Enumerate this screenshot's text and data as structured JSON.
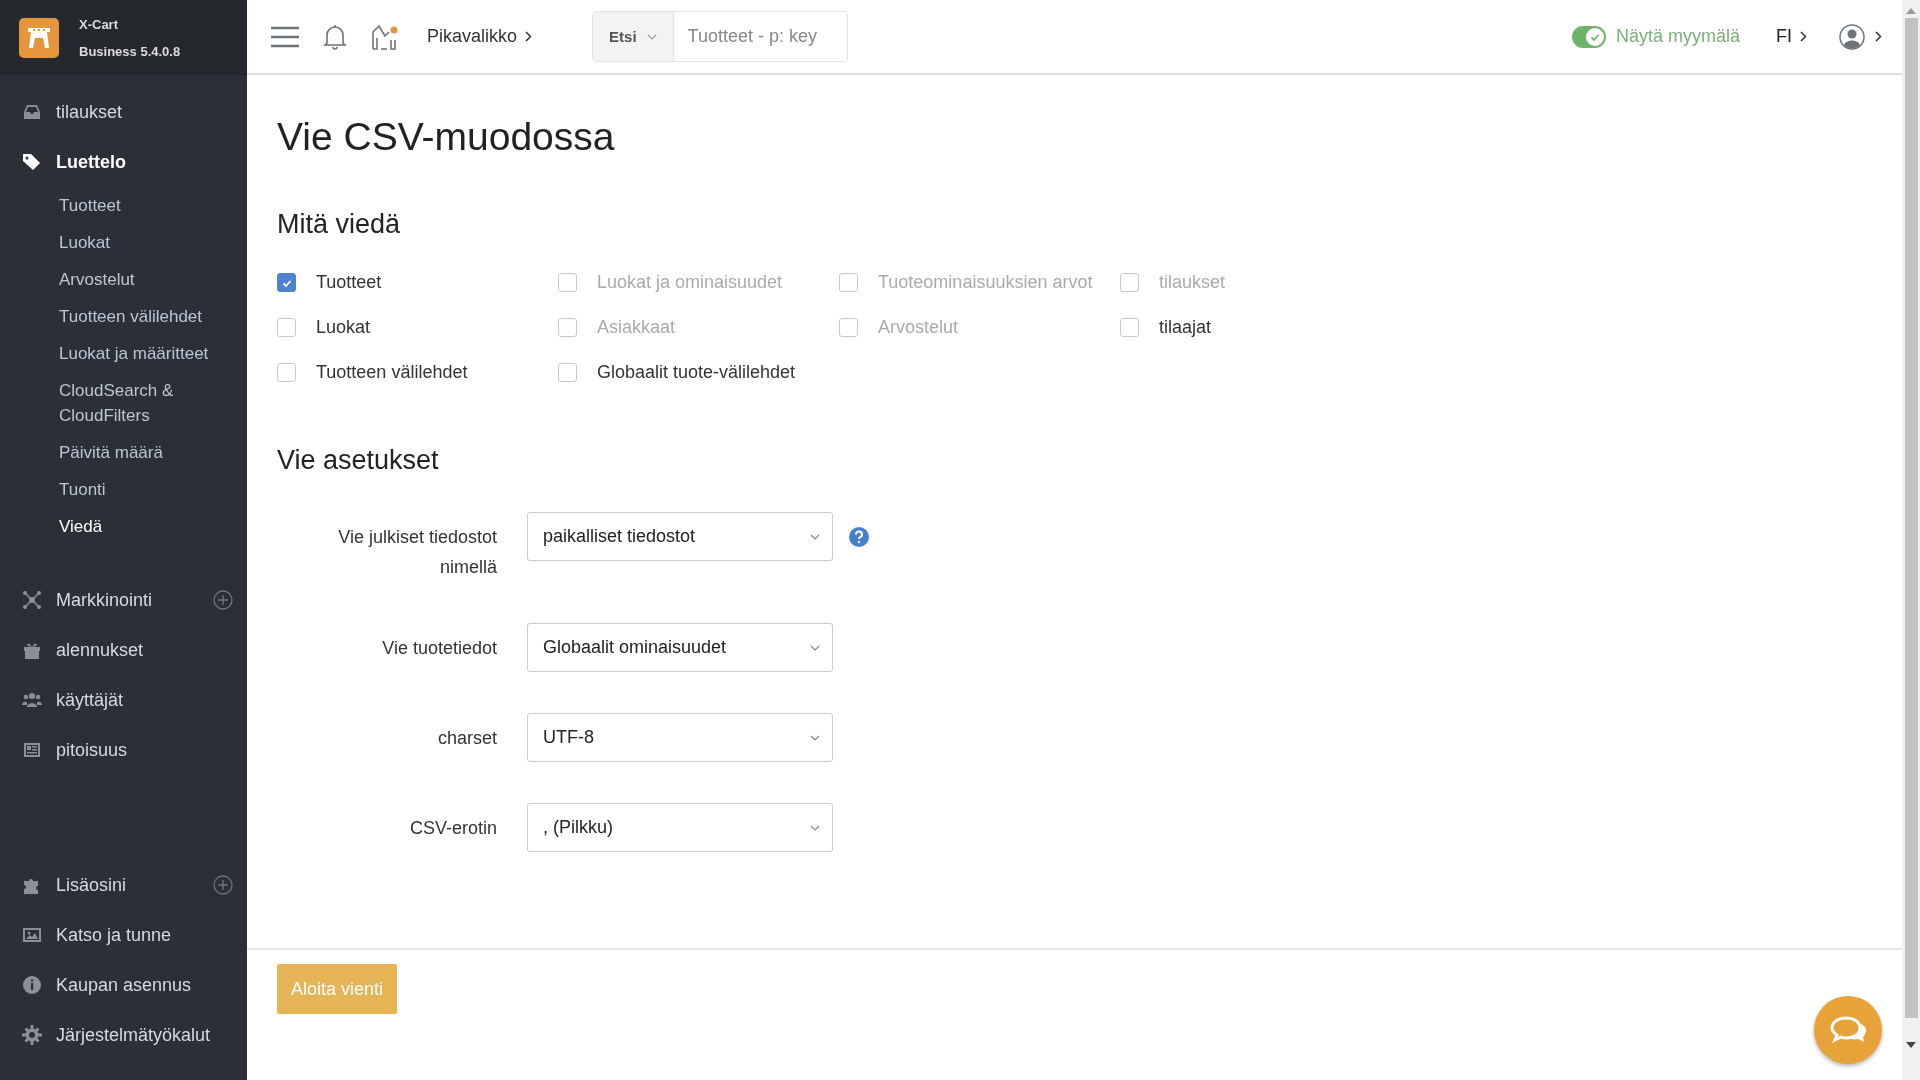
{
  "brand": {
    "name": "X-Cart",
    "version": "Business 5.4.0.8"
  },
  "sidebar": {
    "groups": [
      [
        {
          "label": "tilaukset",
          "expanded": false,
          "add": false
        },
        {
          "label": "Luettelo",
          "expanded": true,
          "add": false,
          "children": [
            {
              "label": "Tuotteet",
              "selected": false
            },
            {
              "label": "Luokat",
              "selected": false
            },
            {
              "label": "Arvostelut",
              "selected": false
            },
            {
              "label": "Tuotteen välilehdet",
              "selected": false
            },
            {
              "label": "Luokat ja määritteet",
              "selected": false
            },
            {
              "label": "CloudSearch & CloudFilters",
              "selected": false
            },
            {
              "label": "Päivitä määrä",
              "selected": false
            },
            {
              "label": "Tuonti",
              "selected": false
            },
            {
              "label": "Viedä",
              "selected": true
            }
          ]
        },
        {
          "label": "Markkinointi",
          "expanded": false,
          "add": true
        },
        {
          "label": "alennukset",
          "expanded": false,
          "add": false
        },
        {
          "label": "käyttäjät",
          "expanded": false,
          "add": false
        },
        {
          "label": "pitoisuus",
          "expanded": false,
          "add": false
        }
      ],
      [
        {
          "label": "Lisäosini",
          "expanded": false,
          "add": true
        },
        {
          "label": "Katso ja tunne",
          "expanded": false,
          "add": false
        },
        {
          "label": "Kaupan asennus",
          "expanded": false,
          "add": false
        },
        {
          "label": "Järjestelmätyökalut",
          "expanded": false,
          "add": false
        }
      ]
    ]
  },
  "topbar": {
    "quick_menu": "Pikavalikko",
    "search": {
      "scope": "Etsi",
      "placeholder": "Tuotteet - p: key"
    },
    "storefront": {
      "label": "Näytä myymälä",
      "on": true
    },
    "language": "FI"
  },
  "page": {
    "title": "Vie CSV-muodossa",
    "export_section": {
      "title": "Mitä viedä",
      "options": [
        {
          "label": "Tuotteet",
          "checked": true,
          "disabled": false
        },
        {
          "label": "Luokat ja ominaisuudet",
          "checked": false,
          "disabled": true
        },
        {
          "label": "Tuoteominaisuuksien arvot",
          "checked": false,
          "disabled": true
        },
        {
          "label": "tilaukset",
          "checked": false,
          "disabled": true
        },
        {
          "label": "Luokat",
          "checked": false,
          "disabled": false
        },
        {
          "label": "Asiakkaat",
          "checked": false,
          "disabled": true
        },
        {
          "label": "Arvostelut",
          "checked": false,
          "disabled": true
        },
        {
          "label": "tilaajat",
          "checked": false,
          "disabled": false
        },
        {
          "label": "Tuotteen välilehdet",
          "checked": false,
          "disabled": false
        },
        {
          "label": "Globaalit tuote-välilehdet",
          "checked": false,
          "disabled": false
        }
      ]
    },
    "settings_section": {
      "title": "Vie asetukset",
      "fields": [
        {
          "label": "Vie julkiset tiedostot nimellä",
          "value": "paikalliset tiedostot",
          "help": true
        },
        {
          "label": "Vie tuotetiedot",
          "value": "Globaalit ominaisuudet",
          "help": false
        },
        {
          "label": "charset",
          "value": "UTF-8",
          "help": false
        },
        {
          "label": "CSV-erotin",
          "value": ", (Pilkku)",
          "help": false
        }
      ]
    },
    "submit": "Aloita vienti"
  }
}
